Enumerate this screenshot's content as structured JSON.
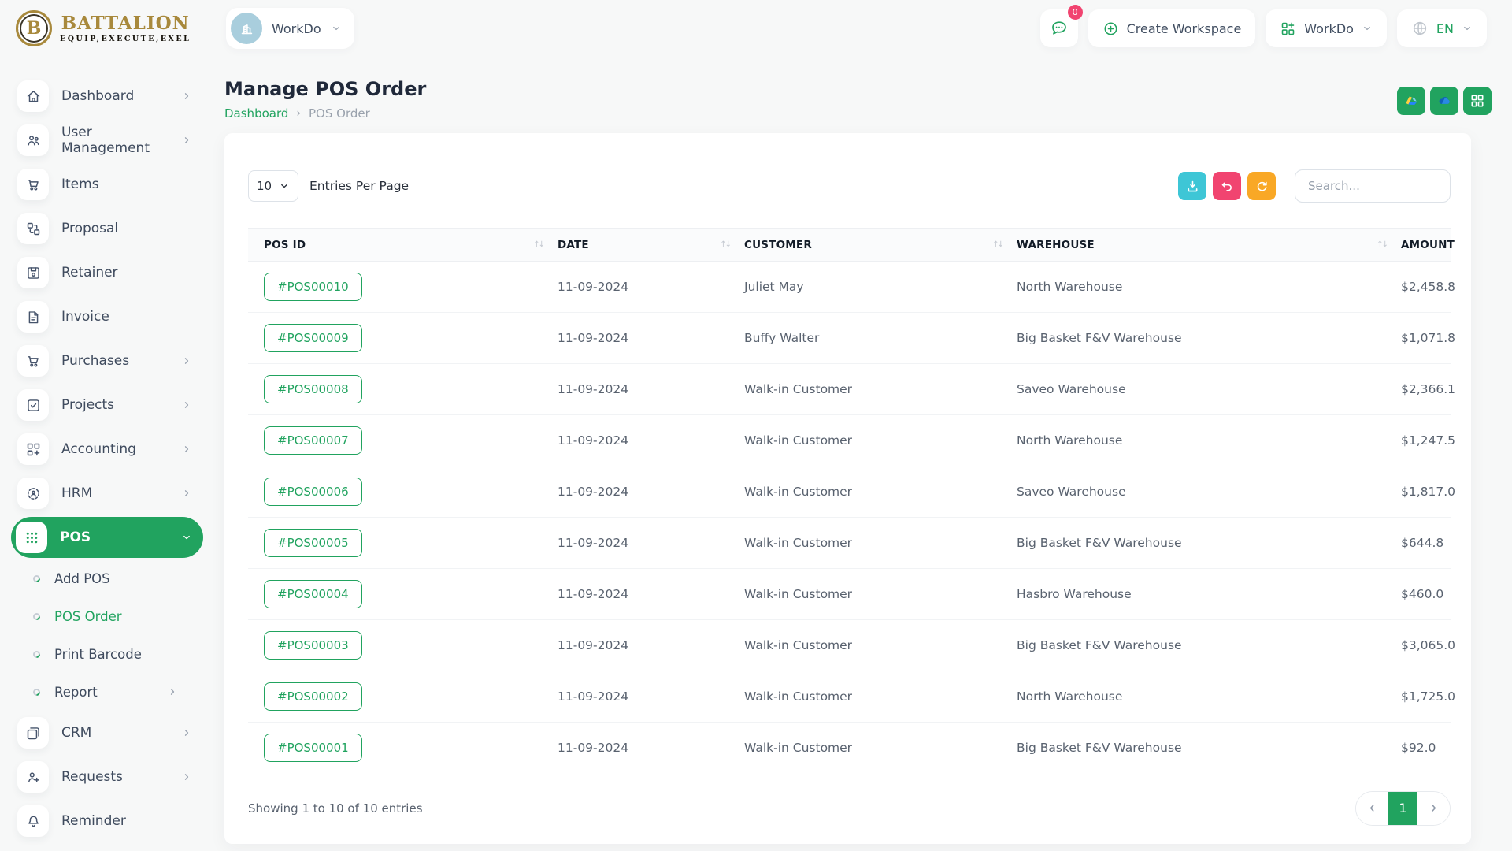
{
  "colors": {
    "primary": "#21a35f",
    "cyan": "#3ec6d6",
    "pink": "#f14470",
    "orange": "#f9a826",
    "gold": "#a8893c"
  },
  "brand": {
    "name": "BATTALION",
    "tagline": "EQUIP,EXECUTE,EXEL",
    "monogram": "B"
  },
  "topbar": {
    "workspace_label": "WorkDo",
    "messages_count": "0",
    "create_workspace_label": "Create Workspace",
    "app_switcher_label": "WorkDo",
    "language": "EN"
  },
  "sidebar": {
    "items": [
      {
        "label": "Dashboard",
        "icon": "home-icon",
        "chevron": "right"
      },
      {
        "label": "User Management",
        "icon": "users-icon",
        "chevron": "right"
      },
      {
        "label": "Items",
        "icon": "cart-icon",
        "chevron": ""
      },
      {
        "label": "Proposal",
        "icon": "swap-squares-icon",
        "chevron": ""
      },
      {
        "label": "Retainer",
        "icon": "floppy-icon",
        "chevron": ""
      },
      {
        "label": "Invoice",
        "icon": "document-icon",
        "chevron": ""
      },
      {
        "label": "Purchases",
        "icon": "cart-icon",
        "chevron": "right"
      },
      {
        "label": "Projects",
        "icon": "check-square-icon",
        "chevron": "right"
      },
      {
        "label": "Accounting",
        "icon": "blocks-plus-icon",
        "chevron": "right"
      },
      {
        "label": "HRM",
        "icon": "org-circle-icon",
        "chevron": "right"
      },
      {
        "label": "POS",
        "icon": "dots-grid-icon",
        "chevron": "down",
        "active": true,
        "submenu": [
          {
            "label": "Add POS",
            "active": false,
            "chevron": ""
          },
          {
            "label": "POS Order",
            "active": true,
            "chevron": ""
          },
          {
            "label": "Print Barcode",
            "active": false,
            "chevron": ""
          },
          {
            "label": "Report",
            "active": false,
            "chevron": "right"
          }
        ]
      },
      {
        "label": "CRM",
        "icon": "overlap-squares-icon",
        "chevron": "right"
      },
      {
        "label": "Requests",
        "icon": "user-plus-icon",
        "chevron": "right"
      },
      {
        "label": "Reminder",
        "icon": "bell-icon",
        "chevron": ""
      }
    ]
  },
  "page": {
    "title": "Manage POS Order",
    "breadcrumb": [
      {
        "label": "Dashboard",
        "link": true
      },
      {
        "label": "POS Order",
        "link": false
      }
    ],
    "quick_actions": [
      {
        "icon": "google-drive-icon"
      },
      {
        "icon": "onedrive-icon"
      },
      {
        "icon": "layout-grid-icon"
      }
    ]
  },
  "toolbar": {
    "entries_per_page_value": "10",
    "entries_per_page_label": "Entries Per Page",
    "search_placeholder": "Search..."
  },
  "table": {
    "columns": [
      {
        "label": "POS ID",
        "sortable": true
      },
      {
        "label": "DATE",
        "sortable": true
      },
      {
        "label": "CUSTOMER",
        "sortable": true
      },
      {
        "label": "WAREHOUSE",
        "sortable": true
      },
      {
        "label": "AMOUNT",
        "sortable": false
      }
    ],
    "rows": [
      {
        "pos_id": "#POS00010",
        "date": "11-09-2024",
        "customer": "Juliet May",
        "warehouse": "North Warehouse",
        "amount": "$2,458.8"
      },
      {
        "pos_id": "#POS00009",
        "date": "11-09-2024",
        "customer": "Buffy Walter",
        "warehouse": "Big Basket F&V Warehouse",
        "amount": "$1,071.8"
      },
      {
        "pos_id": "#POS00008",
        "date": "11-09-2024",
        "customer": "Walk-in Customer",
        "warehouse": "Saveo Warehouse",
        "amount": "$2,366.1"
      },
      {
        "pos_id": "#POS00007",
        "date": "11-09-2024",
        "customer": "Walk-in Customer",
        "warehouse": "North Warehouse",
        "amount": "$1,247.5"
      },
      {
        "pos_id": "#POS00006",
        "date": "11-09-2024",
        "customer": "Walk-in Customer",
        "warehouse": "Saveo Warehouse",
        "amount": "$1,817.0"
      },
      {
        "pos_id": "#POS00005",
        "date": "11-09-2024",
        "customer": "Walk-in Customer",
        "warehouse": "Big Basket F&V Warehouse",
        "amount": "$644.8"
      },
      {
        "pos_id": "#POS00004",
        "date": "11-09-2024",
        "customer": "Walk-in Customer",
        "warehouse": "Hasbro Warehouse",
        "amount": "$460.0"
      },
      {
        "pos_id": "#POS00003",
        "date": "11-09-2024",
        "customer": "Walk-in Customer",
        "warehouse": "Big Basket F&V Warehouse",
        "amount": "$3,065.0"
      },
      {
        "pos_id": "#POS00002",
        "date": "11-09-2024",
        "customer": "Walk-in Customer",
        "warehouse": "North Warehouse",
        "amount": "$1,725.0"
      },
      {
        "pos_id": "#POS00001",
        "date": "11-09-2024",
        "customer": "Walk-in Customer",
        "warehouse": "Big Basket F&V Warehouse",
        "amount": "$92.0"
      }
    ],
    "footer": {
      "showing_text": "Showing 1 to 10 of 10 entries",
      "current_page": "1"
    }
  }
}
